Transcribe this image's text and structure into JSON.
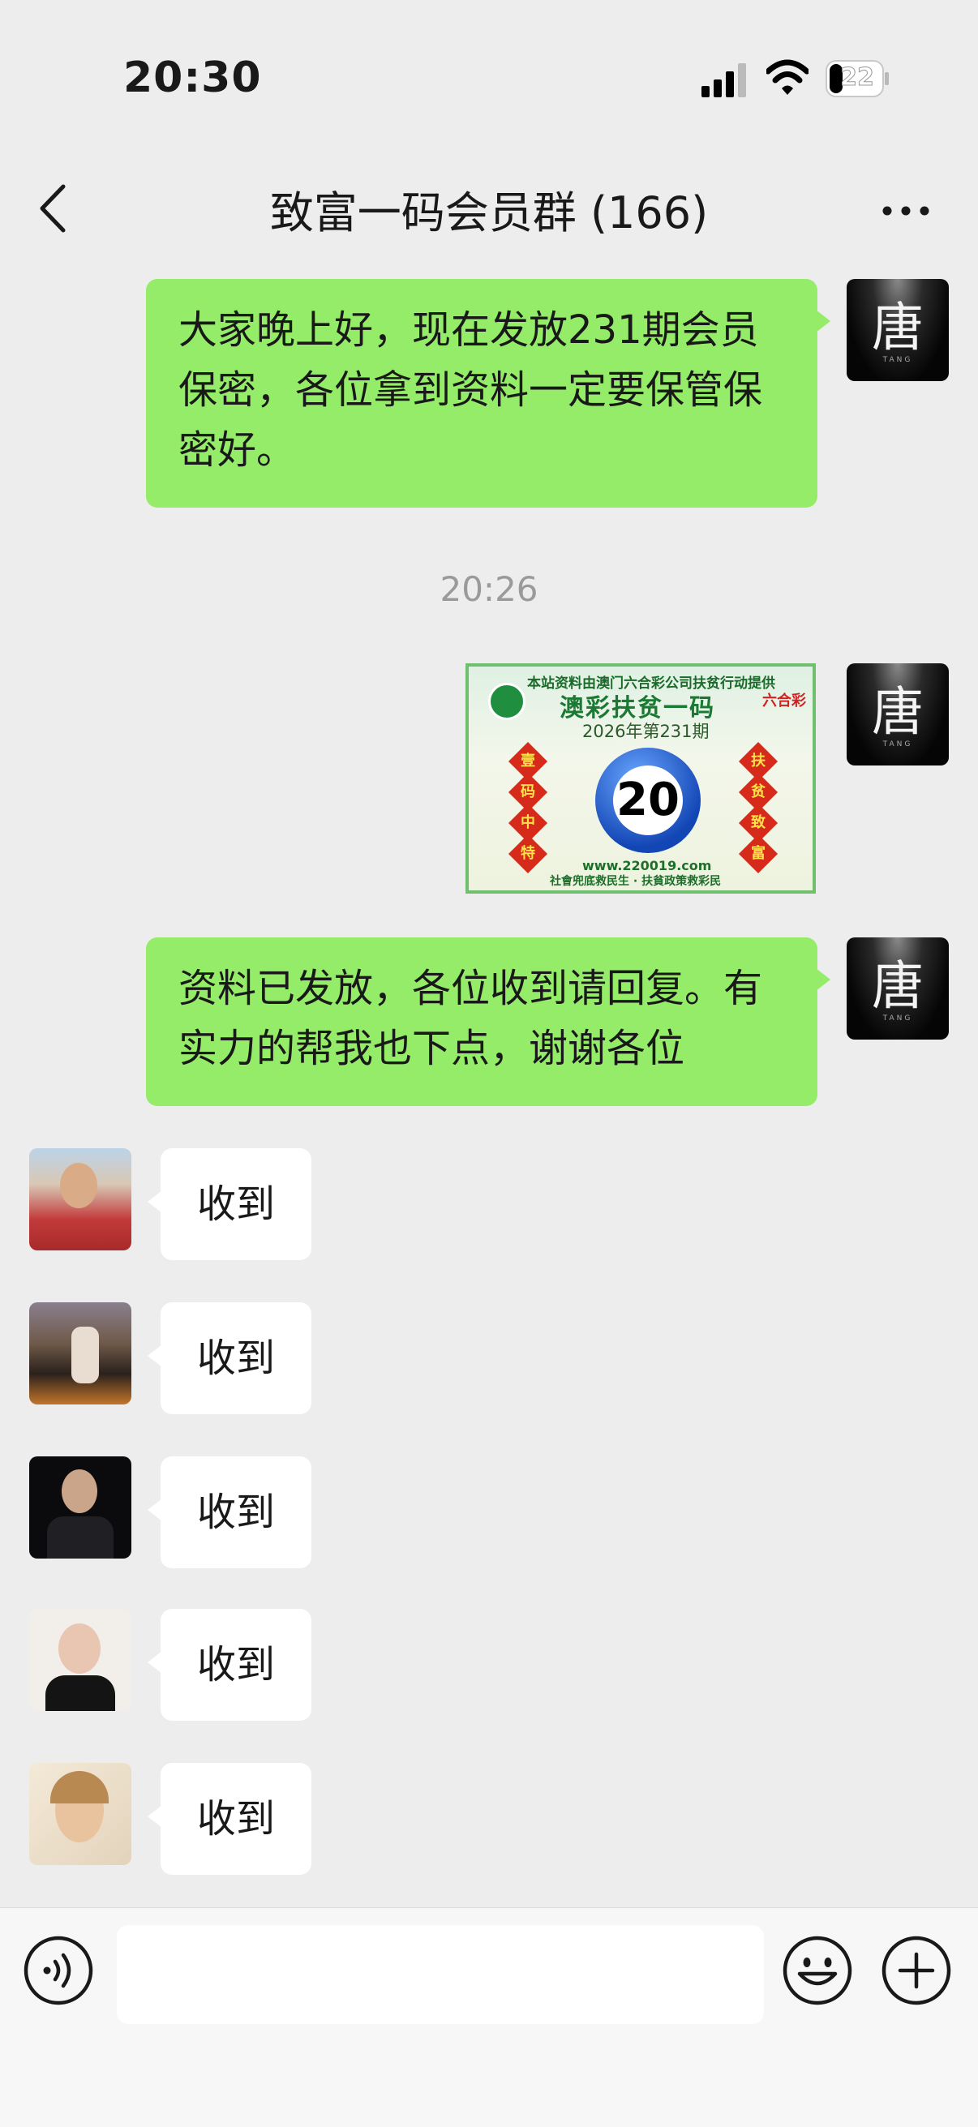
{
  "status_bar": {
    "time": "20:30",
    "battery": "22"
  },
  "nav": {
    "title": "致富一码会员群 (166)"
  },
  "messages": {
    "m1": {
      "text": "大家晚上好，现在发放231期会员保密，各位拿到资料一定要保管保密好。"
    },
    "timestamp": "20:26",
    "image": {
      "header": "本站资料由澳门六合彩公司扶贫行动提供",
      "title": "澳彩扶贫一码",
      "issue": "2026年第231期",
      "number": "20",
      "left_chars": [
        "壹",
        "码",
        "中",
        "特"
      ],
      "right_chars": [
        "扶",
        "贫",
        "致",
        "富"
      ],
      "website": "www.220019.com",
      "footer": "社會兜底救民生 · 扶貧政策救彩民",
      "logo": "六合彩"
    },
    "m3": {
      "text": "资料已发放，各位收到请回复。有实力的帮我也下点，谢谢各位"
    },
    "replies": [
      {
        "text": "收到",
        "avatar": "man-red-shirt"
      },
      {
        "text": "收到",
        "avatar": "city-night"
      },
      {
        "text": "收到",
        "avatar": "man-suit"
      },
      {
        "text": "收到",
        "avatar": "woman-black"
      },
      {
        "text": "收到",
        "avatar": "woman-blonde"
      }
    ]
  },
  "sender_avatar": {
    "char": "唐",
    "sub": "TANG"
  },
  "icons": [
    "back-icon",
    "more-icon",
    "voice-icon",
    "emoji-icon",
    "plus-icon"
  ]
}
